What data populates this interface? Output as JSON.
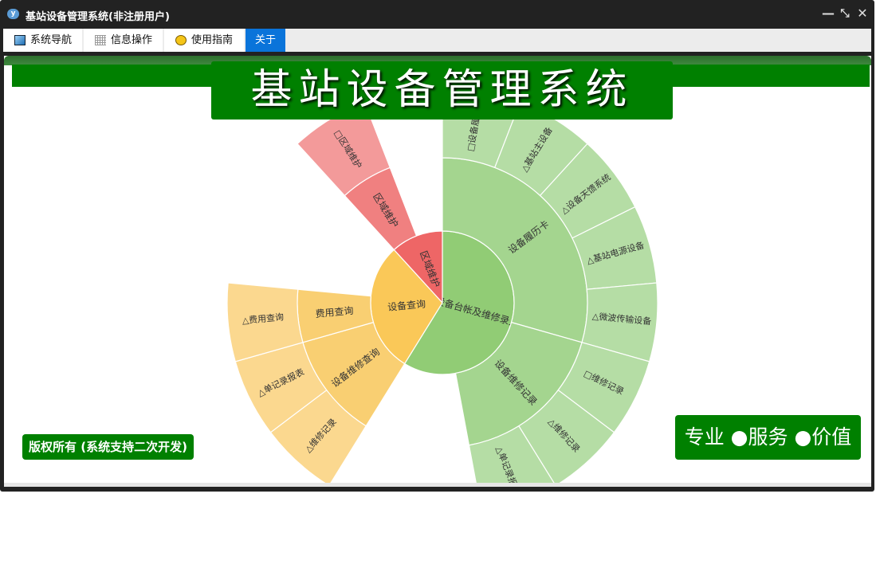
{
  "window": {
    "title": "基站设备管理系统(非注册用户)",
    "controls": {
      "minimize": "—",
      "restore": "⤡",
      "close": "✕"
    }
  },
  "tabs": [
    {
      "label": "系统导航",
      "icon": "monitor-icon",
      "active": false
    },
    {
      "label": "信息操作",
      "icon": "grid-icon",
      "active": false
    },
    {
      "label": "使用指南",
      "icon": "help-icon",
      "active": false
    },
    {
      "label": "关于",
      "active": true
    }
  ],
  "banner": {
    "title": "基站设备管理系统"
  },
  "footer": {
    "copyright": "版权所有 (系统支持二次开发)",
    "motto": "专业 ●服务 ●价值"
  },
  "colors": {
    "brand": "#008000",
    "active_tab": "#0a74da"
  },
  "chart_data": {
    "type": "sunburst",
    "unit_total": 17,
    "nodes": [
      {
        "name": "设备台帐及维修录入",
        "value": 10,
        "color": [
          "#91cc75",
          "#a4d58f",
          "#b5dda5"
        ],
        "children": [
          {
            "name": "设备履历卡",
            "value": 5,
            "children": [
              {
                "name": "□设备履历卡",
                "value": 1
              },
              {
                "name": "△基站主设备",
                "value": 1
              },
              {
                "name": "△设备天馈系统",
                "value": 1
              },
              {
                "name": "△基站电源设备",
                "value": 1
              },
              {
                "name": "△微波传输设备",
                "value": 1
              }
            ]
          },
          {
            "name": "设备维修记录",
            "value": 3,
            "children": [
              {
                "name": "□维修记录",
                "value": 1
              },
              {
                "name": "△维修记录",
                "value": 1
              },
              {
                "name": "△单记录报表",
                "value": 1
              }
            ]
          }
        ]
      },
      {
        "name": "设备查询",
        "value": 5,
        "color": [
          "#fac858",
          "#f9cf72",
          "#fbd88f"
        ],
        "children": [
          {
            "name": "设备维修查询",
            "value": 2,
            "children": [
              {
                "name": "△维修记录",
                "value": 1
              },
              {
                "name": "△单记录报表",
                "value": 1
              }
            ]
          },
          {
            "name": "费用查询",
            "value": 1,
            "children": [
              {
                "name": "△费用查询",
                "value": 1
              }
            ]
          }
        ]
      },
      {
        "name": "区域维护",
        "value": 2,
        "color": [
          "#ee6666",
          "#f08080",
          "#f39a9a"
        ],
        "children": [
          {
            "name": "区域维护",
            "value": 1,
            "children": [
              {
                "name": "□区域维护",
                "value": 1
              }
            ]
          }
        ]
      }
    ]
  }
}
